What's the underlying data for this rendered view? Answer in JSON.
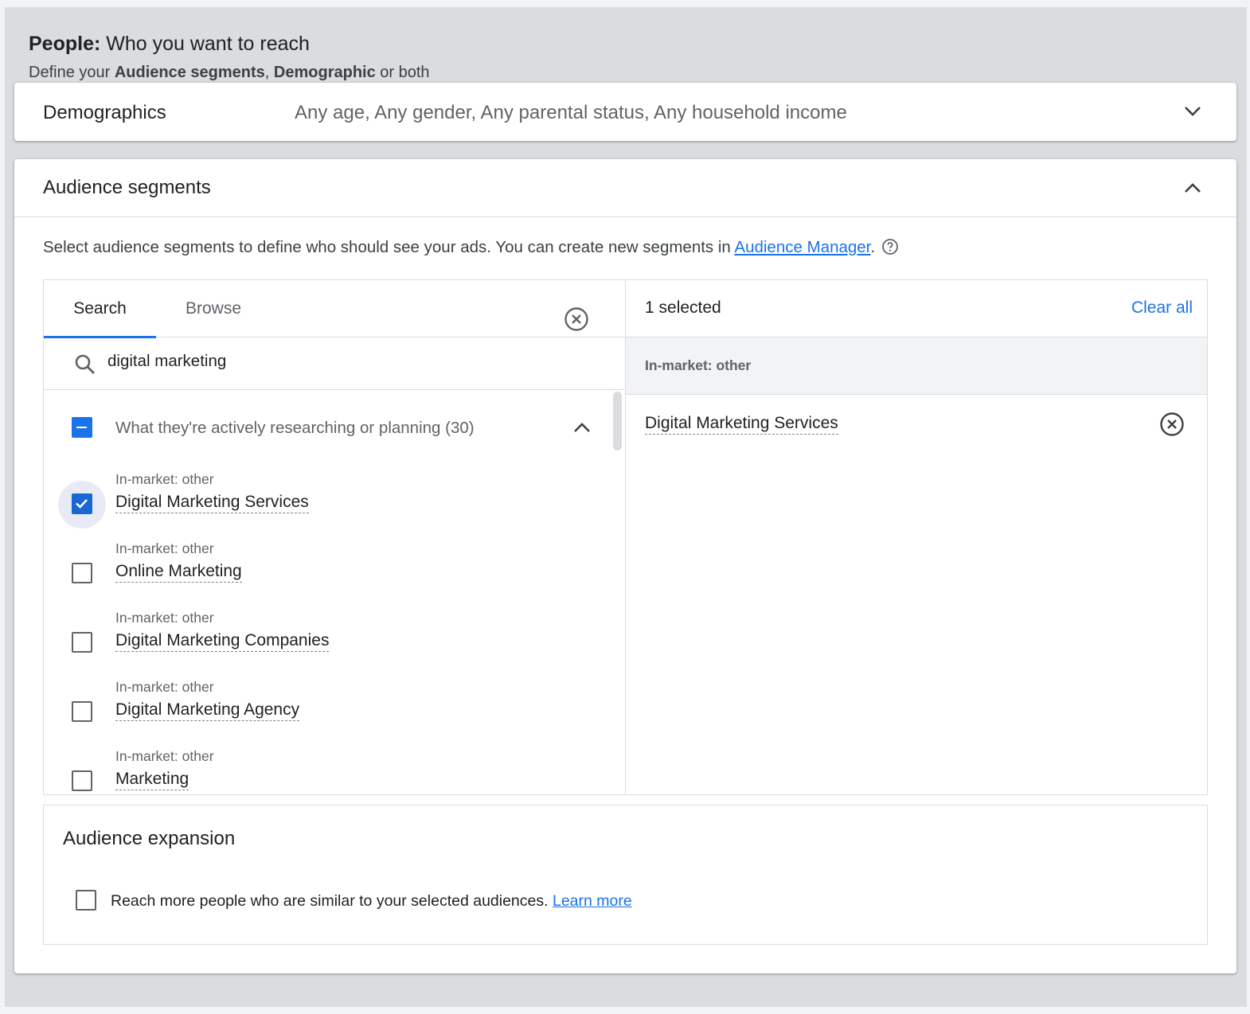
{
  "people": {
    "title_bold": "People:",
    "title_rest": " Who you want to reach",
    "sub_pre": "Define your ",
    "sub_b1": "Audience segments",
    "sub_mid": ", ",
    "sub_b2": "Demographic",
    "sub_post": " or both"
  },
  "demographics": {
    "title": "Demographics",
    "summary": "Any age, Any gender, Any parental status, Any household income",
    "expand_icon": "chevron-down-icon"
  },
  "audience_segments": {
    "title": "Audience segments",
    "collapse_icon": "chevron-up-icon",
    "description_pre": "Select audience segments to define who should see your ads. You can create new segments in ",
    "description_link": "Audience Manager",
    "description_post": ".",
    "tabs": [
      {
        "label": "Search",
        "active": true
      },
      {
        "label": "Browse",
        "active": false
      }
    ],
    "search": {
      "value": "digital marketing",
      "placeholder": ""
    },
    "group": {
      "label": "What they're actively researching or planning (30)",
      "state": "indeterminate"
    },
    "results": [
      {
        "category": "In-market: other",
        "name": "Digital Marketing Services",
        "checked": true
      },
      {
        "category": "In-market: other",
        "name": "Online Marketing",
        "checked": false
      },
      {
        "category": "In-market: other",
        "name": "Digital Marketing Companies",
        "checked": false
      },
      {
        "category": "In-market: other",
        "name": "Digital Marketing Agency",
        "checked": false
      },
      {
        "category": "In-market: other",
        "name": "Marketing",
        "checked": false
      }
    ],
    "selected": {
      "count_label": "1 selected",
      "clear_all": "Clear all",
      "group_label": "In-market: other",
      "items": [
        "Digital Marketing Services"
      ]
    }
  },
  "expansion": {
    "title": "Audience expansion",
    "text": "Reach more people who are similar to your selected audiences. ",
    "link": "Learn more",
    "checked": false
  },
  "colors": {
    "accent": "#1a73e8",
    "checked": "#1967d2",
    "frame": "#dadce0"
  }
}
